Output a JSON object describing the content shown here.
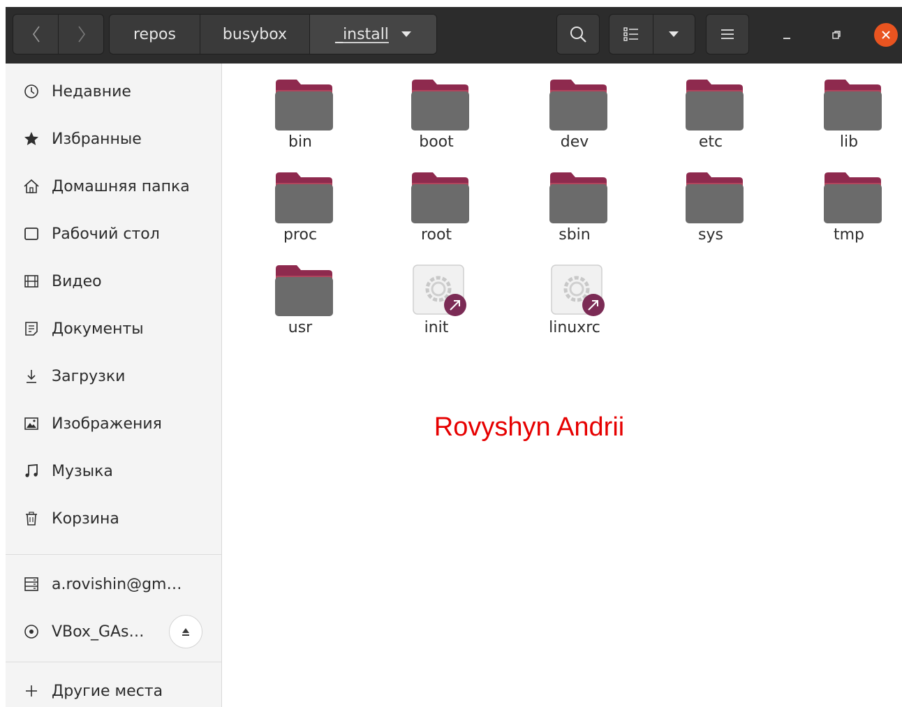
{
  "colors": {
    "headerbar": "#2c2c2c",
    "folder_tab": "#8e2a4e",
    "folder_body": "#6b6b6b",
    "close_button": "#e95420",
    "symlink_badge": "#7b2b55",
    "overlay_text": "#e60000"
  },
  "headerbar": {
    "nav": {
      "back_icon": "chevron-left-icon",
      "forward_icon": "chevron-right-icon"
    },
    "path": [
      "repos",
      "busybox",
      "_install"
    ],
    "controls": {
      "search_icon": "search-icon",
      "view_icon": "list-view-icon",
      "view_menu_icon": "triangle-down-icon",
      "menu_icon": "hamburger-menu-icon",
      "minimize_icon": "minimize-icon",
      "restore_icon": "restore-icon",
      "close_icon": "close-icon"
    }
  },
  "sidebar": {
    "items": [
      {
        "label": "Недавние",
        "icon": "clock-icon"
      },
      {
        "label": "Избранные",
        "icon": "star-icon"
      },
      {
        "label": "Домашняя папка",
        "icon": "home-icon"
      },
      {
        "label": "Рабочий стол",
        "icon": "desktop-icon"
      },
      {
        "label": "Видео",
        "icon": "film-icon"
      },
      {
        "label": "Документы",
        "icon": "document-icon"
      },
      {
        "label": "Загрузки",
        "icon": "download-icon"
      },
      {
        "label": "Изображения",
        "icon": "image-icon"
      },
      {
        "label": "Музыка",
        "icon": "music-icon"
      },
      {
        "label": "Корзина",
        "icon": "trash-icon"
      }
    ],
    "devices": [
      {
        "label": "a.rovishin@gm…",
        "icon": "network-drive-icon"
      },
      {
        "label": "VBox_GAs…",
        "icon": "optical-disc-icon",
        "eject_icon": "eject-icon"
      }
    ],
    "other": {
      "label": "Другие места",
      "icon": "plus-icon"
    }
  },
  "files": [
    {
      "name": "bin",
      "type": "folder"
    },
    {
      "name": "boot",
      "type": "folder"
    },
    {
      "name": "dev",
      "type": "folder"
    },
    {
      "name": "etc",
      "type": "folder"
    },
    {
      "name": "lib",
      "type": "folder"
    },
    {
      "name": "proc",
      "type": "folder"
    },
    {
      "name": "root",
      "type": "folder"
    },
    {
      "name": "sbin",
      "type": "folder"
    },
    {
      "name": "sys",
      "type": "folder"
    },
    {
      "name": "tmp",
      "type": "folder"
    },
    {
      "name": "usr",
      "type": "folder"
    },
    {
      "name": "init",
      "type": "executable-symlink"
    },
    {
      "name": "linuxrc",
      "type": "executable-symlink"
    }
  ],
  "overlay": {
    "text": "Rovyshyn Andrii"
  }
}
